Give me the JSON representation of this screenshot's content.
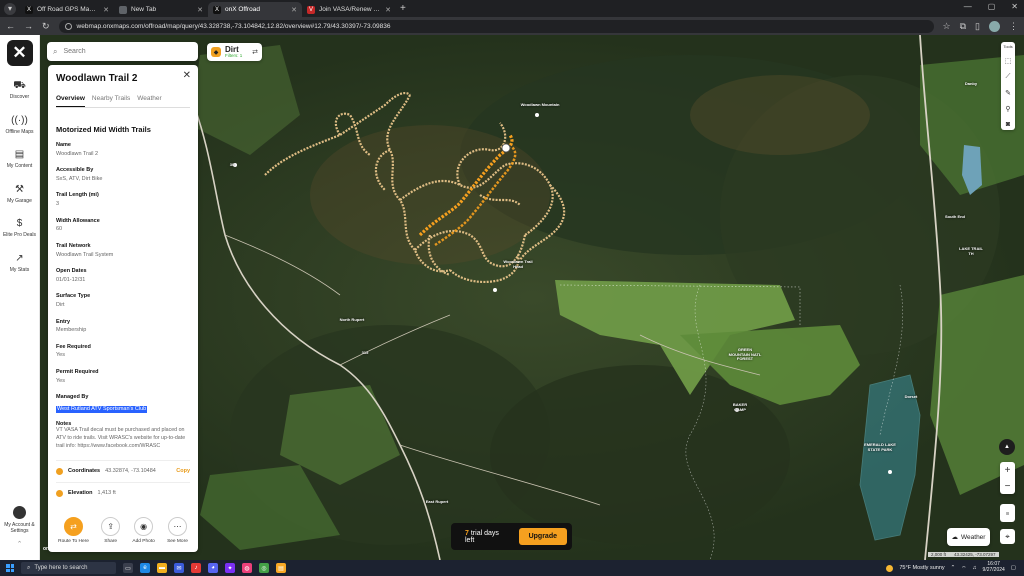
{
  "browser": {
    "tabs": [
      {
        "label": "Off Road GPS Maps App: Find",
        "fav": "X",
        "fav_color": "#111111",
        "active": false
      },
      {
        "label": "New Tab",
        "fav": "",
        "fav_color": "#5f6368",
        "active": false
      },
      {
        "label": "onX Offroad",
        "fav": "X",
        "fav_color": "#111111",
        "active": true
      },
      {
        "label": "Join VASA/Renew TAG - VASA",
        "fav": "V",
        "fav_color": "#c62828",
        "active": false
      }
    ],
    "url": "webmap.onxmaps.com/offroad/map/query/43.328738,-73.104842,12.82/overview#12.79/43.30397/-73.09836"
  },
  "nav": {
    "items": [
      {
        "label": "Discover",
        "icon": "discover-icon",
        "glyph": "⛟"
      },
      {
        "label": "Offline Maps",
        "icon": "offline-maps-icon",
        "glyph": "((·))"
      },
      {
        "label": "My Content",
        "icon": "my-content-icon",
        "glyph": "▤"
      },
      {
        "label": "My Garage",
        "icon": "garage-icon",
        "glyph": "⚒"
      },
      {
        "label": "Elite Pro Deals",
        "icon": "deals-icon",
        "glyph": "$"
      },
      {
        "label": "My Stats",
        "icon": "stats-icon",
        "glyph": "↗"
      }
    ],
    "account_label": "My Account & Settings"
  },
  "search": {
    "placeholder": "Search"
  },
  "filter": {
    "title": "Dirt",
    "subtitle": "Filters: 1"
  },
  "panel": {
    "title": "Woodlawn Trail 2",
    "tabs": [
      "Overview",
      "Nearby Trails",
      "Weather"
    ],
    "section_title": "Motorized Mid Width Trails",
    "fields": [
      {
        "key": "Name",
        "value": "Woodlawn Trail 2"
      },
      {
        "key": "Accessible By",
        "value": "SxS, ATV, Dirt Bike"
      },
      {
        "key": "Trail Length (mi)",
        "value": "3"
      },
      {
        "key": "Width Allowance",
        "value": "60"
      },
      {
        "key": "Trail Network",
        "value": "Woodlawn Trail System"
      },
      {
        "key": "Open Dates",
        "value": "01/01-12/31"
      },
      {
        "key": "Surface Type",
        "value": "Dirt"
      },
      {
        "key": "Entry",
        "value": "Membership"
      },
      {
        "key": "Fee Required",
        "value": "Yes"
      },
      {
        "key": "Permit Required",
        "value": "Yes"
      },
      {
        "key": "Managed By",
        "value": "West Rutland ATV Sportsman's Club"
      }
    ],
    "notes_label": "Notes",
    "notes": "VT VASA Trail decal must be purchased and placed on ATV to ride trails. Visit WRASC's website for up-to-date trail info: https://www.facebook.com/WRASC",
    "coordinates_label": "Coordinates",
    "coordinates_value": "43.32874, -73.10484",
    "copy_label": "Copy",
    "elevation_label": "Elevation",
    "elevation_value": "1,413 ft",
    "actions": [
      {
        "label": "Route To Here",
        "icon": "route-icon",
        "glyph": "⇄"
      },
      {
        "label": "Share",
        "icon": "share-icon",
        "glyph": "⇪"
      },
      {
        "label": "Add Photo",
        "icon": "camera-icon",
        "glyph": "◉"
      },
      {
        "label": "See More",
        "icon": "more-icon",
        "glyph": "⋯"
      }
    ]
  },
  "tools": {
    "label": "Tools"
  },
  "map": {
    "labels": {
      "woodlawn_trail": "Woodlawn Trail Head",
      "woodlawn_mtn": "Woodlawn Mountain",
      "north_rupert": "North Rupert",
      "east_rupert": "East Rupert",
      "gmnf": "GREEN MOUNTAIN NATL FOREST",
      "emerald_lake": "EMERALD LAKE STATE PARK",
      "lake_trail": "LAKE TRAIL TH",
      "south_end": "South End",
      "baker": "BAKER CAMP",
      "route30": "30",
      "route315": "315",
      "dorset": "Dorset",
      "danby": "Danby"
    },
    "scale_left": "2,000 ft",
    "scale_right": "43.32425, -73.07297",
    "watermark": "onXmaps"
  },
  "trial": {
    "count": "7",
    "text": "trial days left",
    "button": "Upgrade"
  },
  "weather_button": "Weather",
  "taskbar": {
    "search_placeholder": "Type here to search",
    "weather": "75°F  Mostly sunny",
    "time": "16:07",
    "date": "9/27/2024"
  },
  "colors": {
    "accent": "#f5a01f",
    "highlight": "#2962ff"
  }
}
